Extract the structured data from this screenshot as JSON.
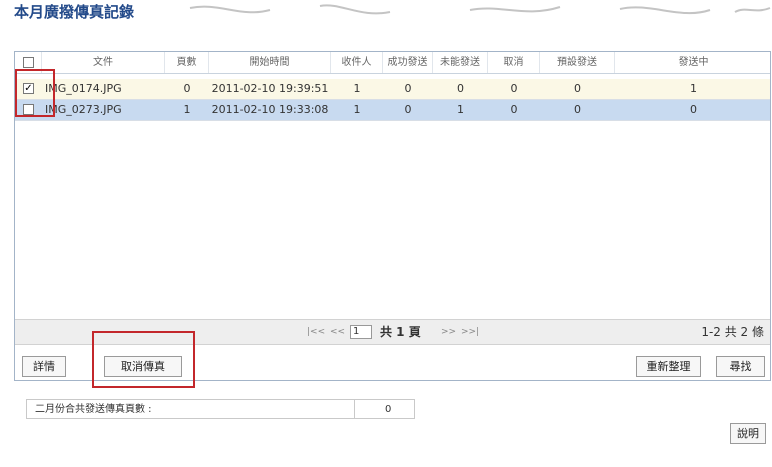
{
  "page": {
    "title": "本月廣撥傳真記錄"
  },
  "table": {
    "columns": [
      "文件",
      "頁數",
      "開始時間",
      "收件人",
      "成功發送",
      "未能發送",
      "取消",
      "預設發送",
      "發送中"
    ],
    "rows": [
      {
        "checked": true,
        "file": "IMG_0174.JPG",
        "pages": "0",
        "start_time": "2011-02-10 19:39:51",
        "recipients": "1",
        "success": "0",
        "failed": "0",
        "cancelled": "0",
        "scheduled": "0",
        "sending": "1"
      },
      {
        "checked": false,
        "file": "IMG_0273.JPG",
        "pages": "1",
        "start_time": "2011-02-10 19:33:08",
        "recipients": "1",
        "success": "0",
        "failed": "1",
        "cancelled": "0",
        "scheduled": "0",
        "sending": "0"
      }
    ]
  },
  "pager": {
    "current_page": "1",
    "total_pages_label": "共 1 頁",
    "range_label": "1-2 共 2 條"
  },
  "actions": {
    "details": "詳情",
    "cancel_fax": "取消傳真",
    "refresh": "重新整理",
    "search": "尋找"
  },
  "footer": {
    "label": "二月份合共發送傳真頁數 :",
    "value": "0"
  },
  "help": {
    "label": "說明"
  }
}
